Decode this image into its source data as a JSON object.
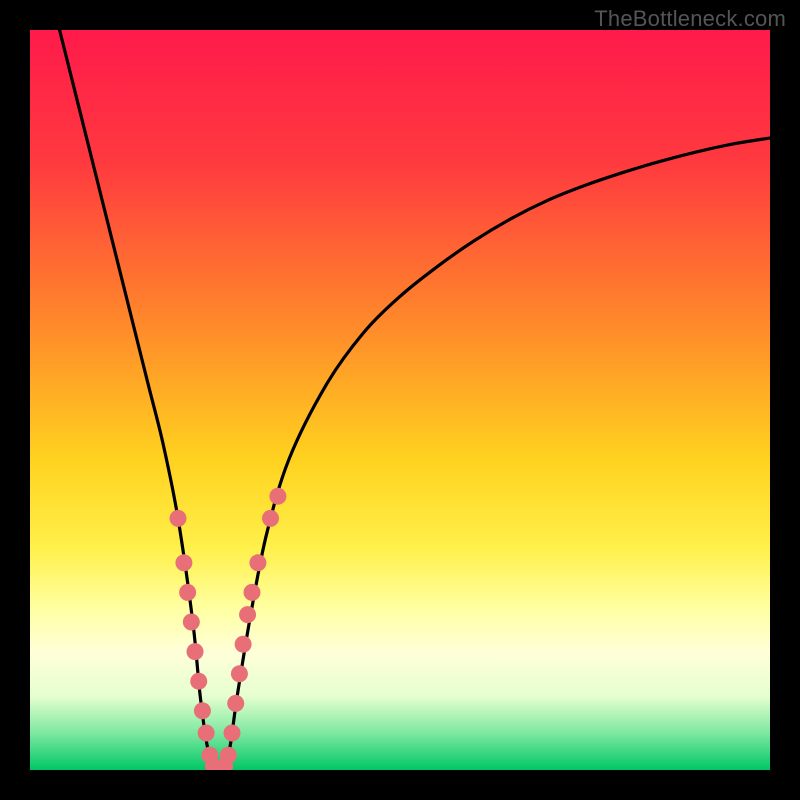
{
  "watermark": "TheBottleneck.com",
  "colors": {
    "frame": "#000000",
    "curve": "#000000",
    "dot": "#e86f77",
    "gradient_stops": [
      {
        "offset": 0.0,
        "color": "#ff1a4b"
      },
      {
        "offset": 0.18,
        "color": "#ff3a3f"
      },
      {
        "offset": 0.4,
        "color": "#ff8a2a"
      },
      {
        "offset": 0.58,
        "color": "#ffd21f"
      },
      {
        "offset": 0.7,
        "color": "#fff04a"
      },
      {
        "offset": 0.78,
        "color": "#ffffa0"
      },
      {
        "offset": 0.84,
        "color": "#ffffd8"
      },
      {
        "offset": 0.9,
        "color": "#e6ffd0"
      },
      {
        "offset": 0.95,
        "color": "#7de8a0"
      },
      {
        "offset": 1.0,
        "color": "#00c765"
      }
    ]
  },
  "chart_data": {
    "type": "line",
    "title": "",
    "xlabel": "",
    "ylabel": "",
    "xlim": [
      0,
      100
    ],
    "ylim": [
      0,
      100
    ],
    "series": [
      {
        "name": "bottleneck-curve",
        "x": [
          4,
          6,
          8,
          10,
          12,
          14,
          16,
          18,
          20,
          22,
          23,
          24,
          25,
          26,
          27,
          28,
          30,
          32,
          35,
          40,
          45,
          50,
          55,
          60,
          65,
          70,
          75,
          80,
          85,
          90,
          95,
          100
        ],
        "y": [
          100,
          92,
          84,
          76,
          68,
          60,
          52,
          44,
          34,
          20,
          10,
          3,
          0,
          0,
          3,
          10,
          22,
          32,
          42,
          52,
          59,
          64,
          68,
          71.5,
          74.5,
          77,
          79,
          80.7,
          82.2,
          83.5,
          84.6,
          85.4
        ]
      }
    ],
    "scatter": {
      "name": "highlight-dots",
      "points": [
        {
          "x": 20.0,
          "y": 34
        },
        {
          "x": 20.8,
          "y": 28
        },
        {
          "x": 21.3,
          "y": 24
        },
        {
          "x": 21.8,
          "y": 20
        },
        {
          "x": 22.3,
          "y": 16
        },
        {
          "x": 22.8,
          "y": 12
        },
        {
          "x": 23.3,
          "y": 8
        },
        {
          "x": 23.8,
          "y": 5
        },
        {
          "x": 24.3,
          "y": 2
        },
        {
          "x": 24.8,
          "y": 0.5
        },
        {
          "x": 25.3,
          "y": 0
        },
        {
          "x": 25.8,
          "y": 0
        },
        {
          "x": 26.3,
          "y": 0.5
        },
        {
          "x": 26.8,
          "y": 2
        },
        {
          "x": 27.3,
          "y": 5
        },
        {
          "x": 27.8,
          "y": 9
        },
        {
          "x": 28.3,
          "y": 13
        },
        {
          "x": 28.8,
          "y": 17
        },
        {
          "x": 29.4,
          "y": 21
        },
        {
          "x": 30.0,
          "y": 24
        },
        {
          "x": 30.8,
          "y": 28
        },
        {
          "x": 32.5,
          "y": 34
        },
        {
          "x": 33.5,
          "y": 37
        }
      ]
    }
  }
}
